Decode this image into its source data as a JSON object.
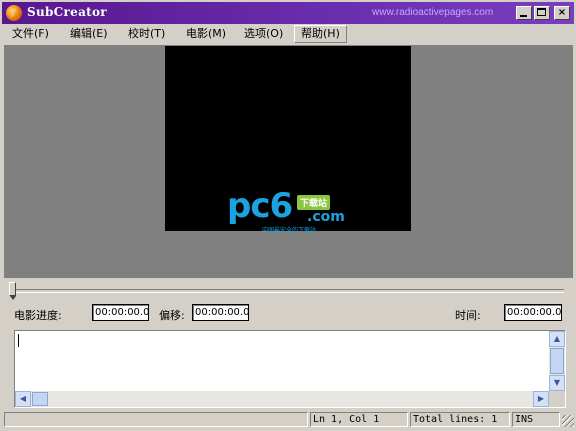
{
  "window": {
    "title": "SubCreator",
    "url": "www.radioactivepages.com",
    "close_glyph": "×"
  },
  "menu": {
    "items": [
      {
        "label": "文件(F)"
      },
      {
        "label": "编辑(E)"
      },
      {
        "label": "校时(T)"
      },
      {
        "label": "电影(M)"
      },
      {
        "label": "选项(O)"
      },
      {
        "label": "帮助(H)"
      }
    ]
  },
  "video": {
    "logo_main": "pc6",
    "logo_tag": "下载站",
    "logo_domain": ".com",
    "logo_sub": "中国最安全的下载站"
  },
  "timing": {
    "progress_label": "电影进度:",
    "progress_value": "00:00:00.0",
    "offset_label": "偏移:",
    "offset_value": "00:00:00.0",
    "time_label": "时间:",
    "time_value": "00:00:00.0"
  },
  "scrollbar": {
    "up_glyph": "▲",
    "down_glyph": "▼",
    "left_glyph": "◀",
    "right_glyph": "▶"
  },
  "status": {
    "position": "Ln 1, Col 1",
    "total": "Total lines: 1",
    "mode": "INS"
  },
  "colors": {
    "title_bar": "#58168e",
    "video_background": "#808080",
    "screen": "#000000"
  }
}
